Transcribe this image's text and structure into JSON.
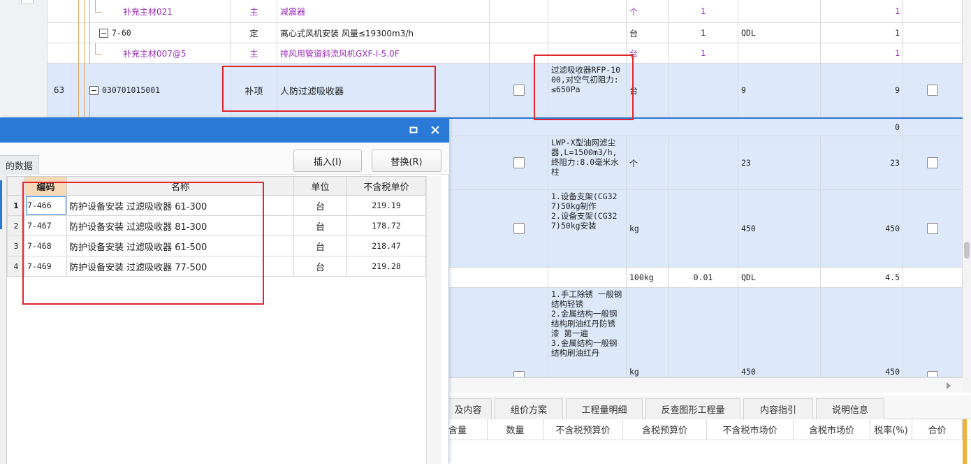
{
  "main_table": {
    "rows": [
      {
        "code": "补充主材021",
        "type": "主",
        "name": "减震器",
        "desc": "",
        "unit": "个",
        "qty_coef": "1",
        "qty_expr": "",
        "qty": "1",
        "purple": true
      },
      {
        "code": "7-60",
        "type": "定",
        "name": "离心式风机安装 风量≤19300m3/h",
        "desc": "",
        "unit": "台",
        "qty_coef": "1",
        "qty_expr": "QDL",
        "qty": "1",
        "purple": false
      },
      {
        "code": "补充主材007@5",
        "type": "主",
        "name": "排风用管道斜流风机GXF-I-5.0F",
        "desc": "",
        "unit": "台",
        "qty_coef": "1",
        "qty_expr": "",
        "qty": "1",
        "purple": true
      },
      {
        "seq": "63",
        "code": "030701015001",
        "type": "补项",
        "name": "人防过滤吸收器",
        "desc": "过滤吸收器RFP-1000,对空气初阻力:≤650Pa",
        "unit": "台",
        "qty_coef": "",
        "qty_expr": "9",
        "qty": "9",
        "purple": false
      },
      {
        "qty": "0"
      },
      {
        "desc": "LWP-X型油网滤尘器,L=1500m3/h,终阻力:8.0毫米水柱",
        "unit": "个",
        "qty_expr": "23",
        "qty": "23"
      },
      {
        "desc": "1.设备支架(CG327)50kg制作\n2.设备支架(CG327)50kg安装",
        "unit": "kg",
        "qty_expr": "450",
        "qty": "450"
      },
      {
        "unit": "100kg",
        "qty_coef": "0.01",
        "qty_expr": "QDL",
        "qty": "4.5"
      },
      {
        "desc": "1.手工除锈 一般钢结构轻锈\n2.金属结构一般钢结构刷油红丹防锈漆 第一遍\n3.金属结构一般钢结构刷油红丹",
        "unit": "kg",
        "qty_expr": "450",
        "qty": "450"
      }
    ]
  },
  "bottom_tabs": [
    "及内容",
    "组价方案",
    "工程量明细",
    "反查图形工程量",
    "内容指引",
    "说明信息"
  ],
  "bottom_header": [
    "含量",
    "数量",
    "不含税预算价",
    "含税预算价",
    "不含税市场价",
    "含税市场价",
    "税率(%)",
    "合价"
  ],
  "dialog": {
    "left_tab": "的数据",
    "insert_label": "插入(I)",
    "replace_label": "替换(R)",
    "columns": [
      "编码",
      "名称",
      "单位",
      "不含税单价"
    ],
    "rows": [
      {
        "n": "1",
        "code": "7-466",
        "name": "防护设备安装 过滤吸收器 61-300",
        "unit": "台",
        "price": "219.19"
      },
      {
        "n": "2",
        "code": "7-467",
        "name": "防护设备安装 过滤吸收器 81-300",
        "unit": "台",
        "price": "178.72"
      },
      {
        "n": "3",
        "code": "7-468",
        "name": "防护设备安装 过滤吸收器 61-500",
        "unit": "台",
        "price": "218.47"
      },
      {
        "n": "4",
        "code": "7-469",
        "name": "防护设备安装 过滤吸收器 77-500",
        "unit": "台",
        "price": "219.28"
      }
    ]
  },
  "colors": {
    "accent": "#2a79d6",
    "highlight_box": "#e0262d",
    "purple_text": "#9b2db8"
  }
}
